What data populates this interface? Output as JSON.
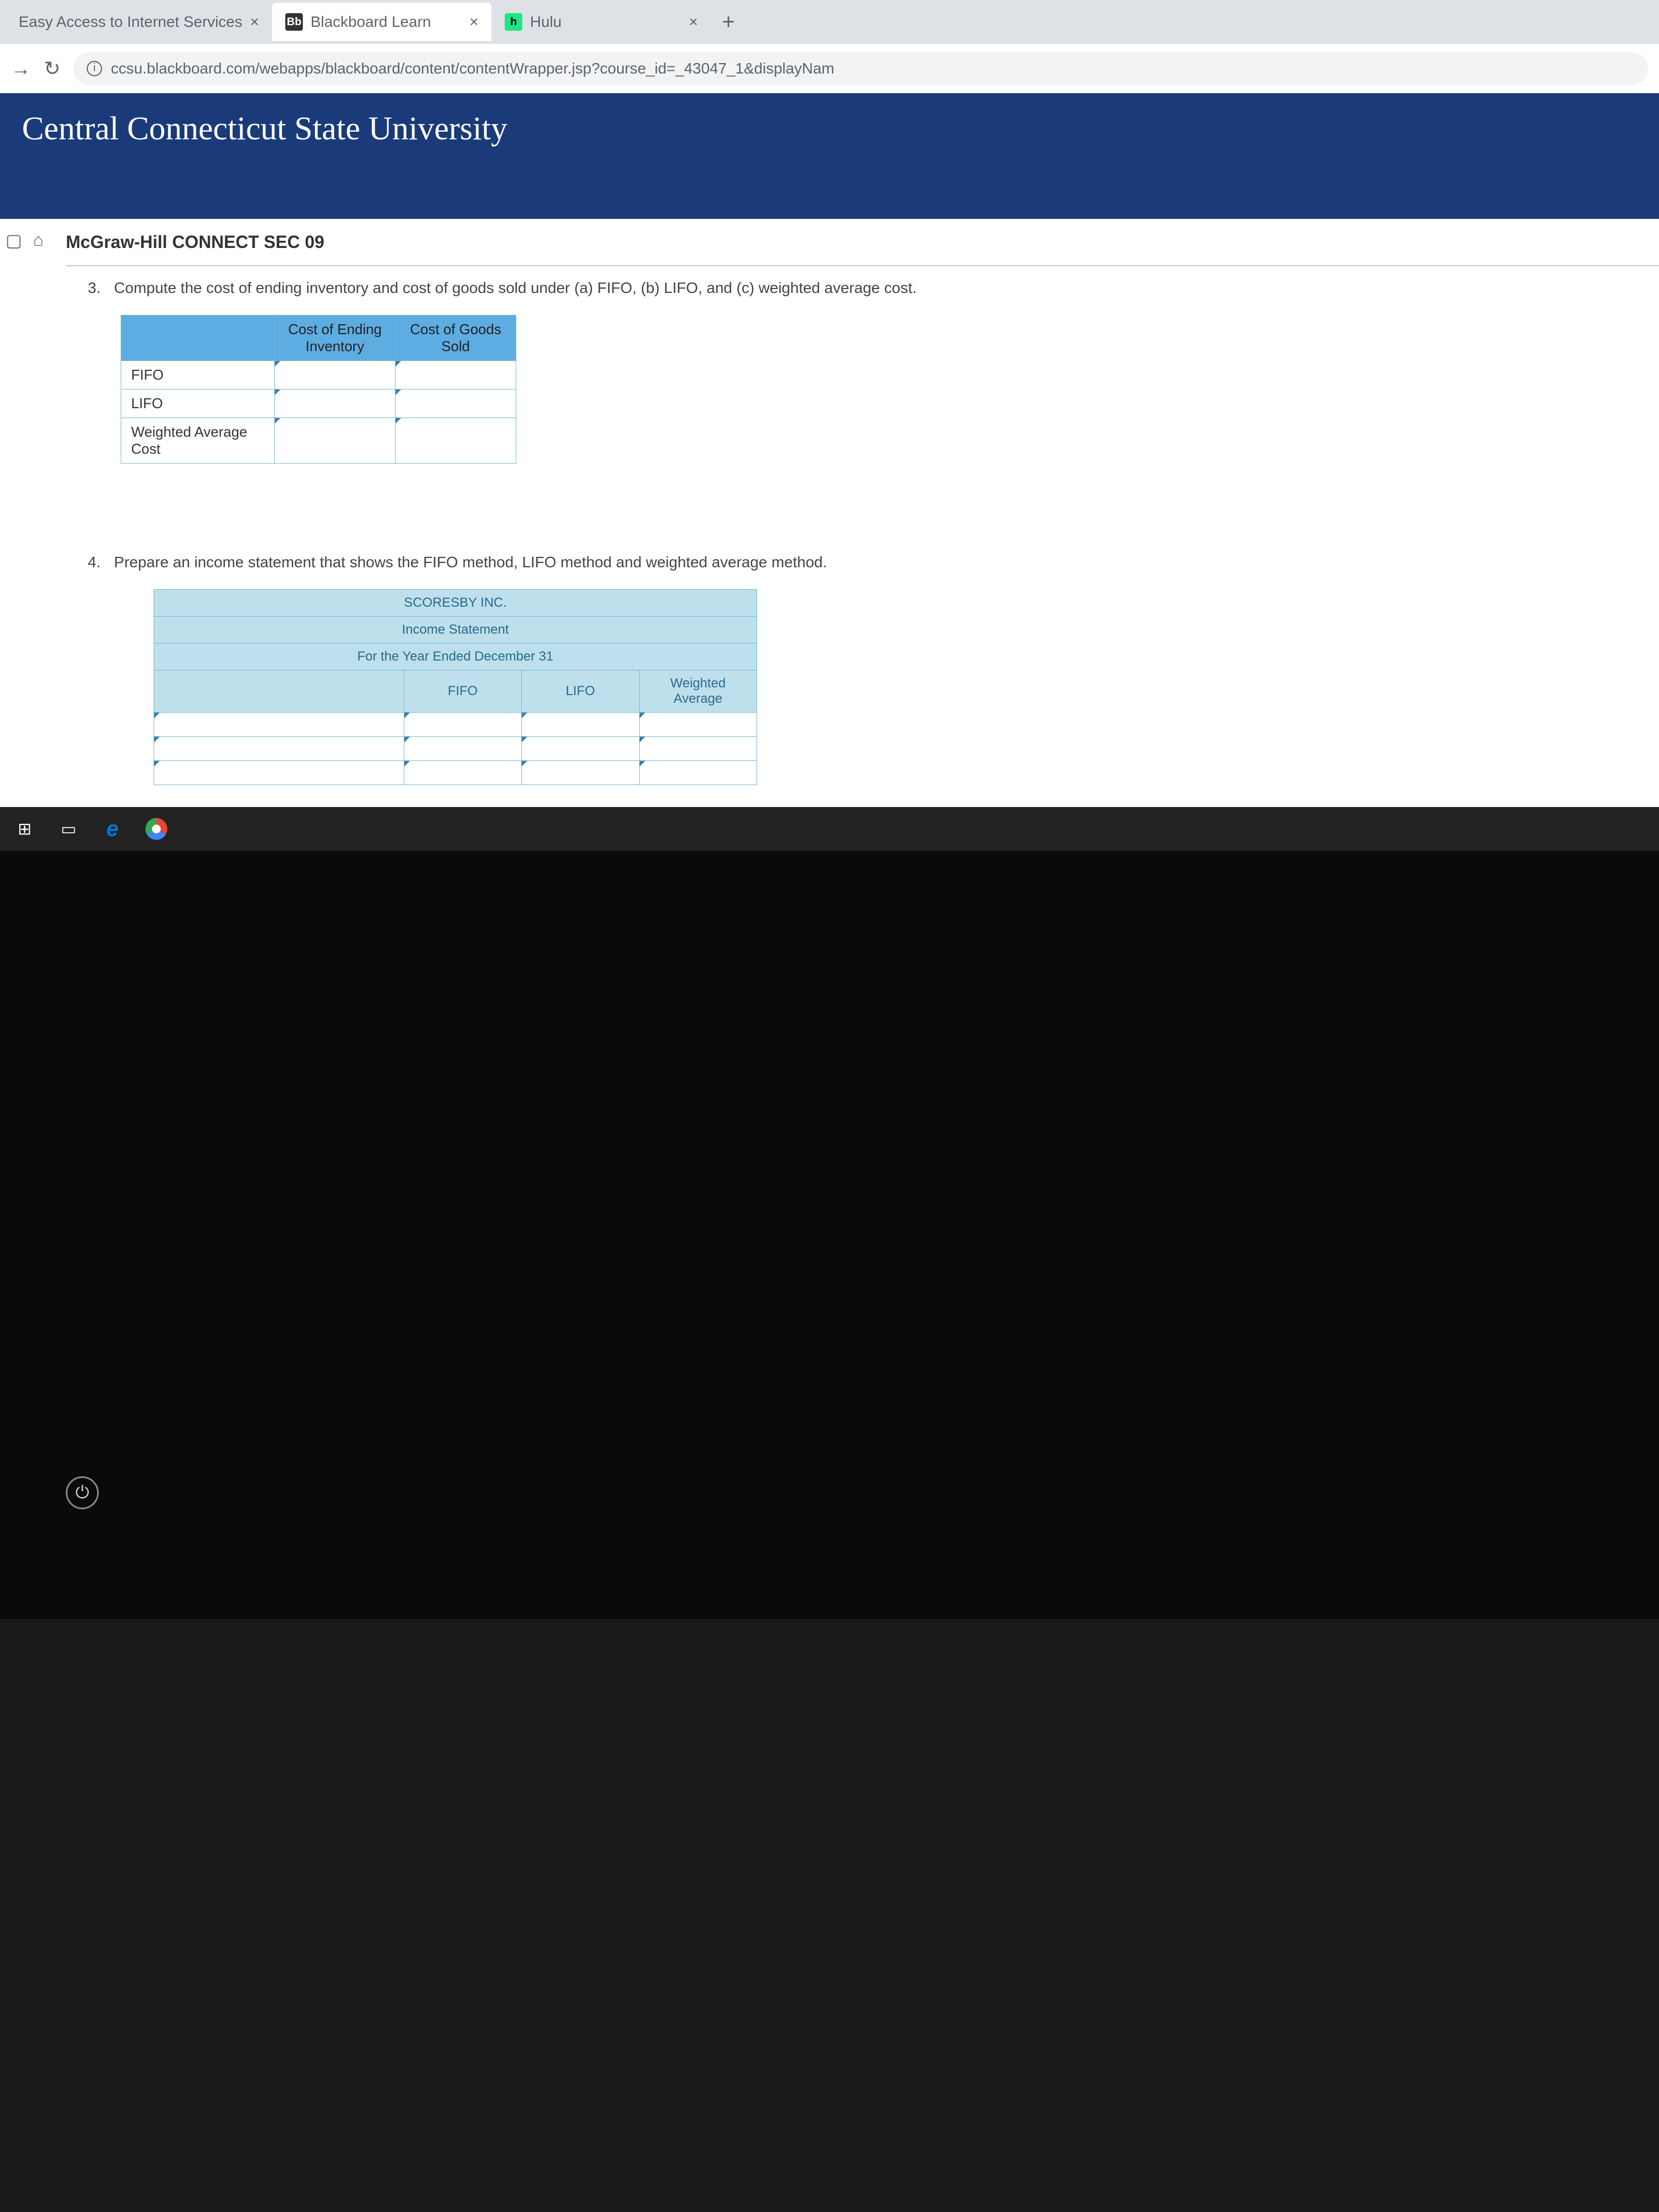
{
  "browser": {
    "tabs": [
      {
        "title": "Easy Access to Internet Services",
        "favicon": "",
        "active": false
      },
      {
        "title": "Blackboard Learn",
        "favicon": "Bb",
        "active": true
      },
      {
        "title": "Hulu",
        "favicon": "h",
        "active": false
      }
    ],
    "url": "ccsu.blackboard.com/webapps/blackboard/content/contentWrapper.jsp?course_id=_43047_1&displayNam"
  },
  "header": {
    "title": "Central Connecticut State University"
  },
  "page": {
    "breadcrumb": "McGraw-Hill CONNECT SEC 09",
    "question3": {
      "number": "3.",
      "text": "Compute the cost of ending inventory and cost of goods sold under (a) FIFO, (b) LIFO, and (c) weighted average cost.",
      "table": {
        "columns": [
          "Cost of Ending Inventory",
          "Cost of Goods Sold"
        ],
        "rows": [
          "FIFO",
          "LIFO",
          "Weighted Average Cost"
        ]
      }
    },
    "question4": {
      "number": "4.",
      "text": "Prepare an income statement that shows the FIFO method, LIFO method and weighted average method.",
      "table": {
        "title1": "SCORESBY INC.",
        "title2": "Income Statement",
        "title3": "For the Year Ended December 31",
        "columns": [
          "FIFO",
          "LIFO",
          "Weighted Average"
        ]
      }
    }
  }
}
